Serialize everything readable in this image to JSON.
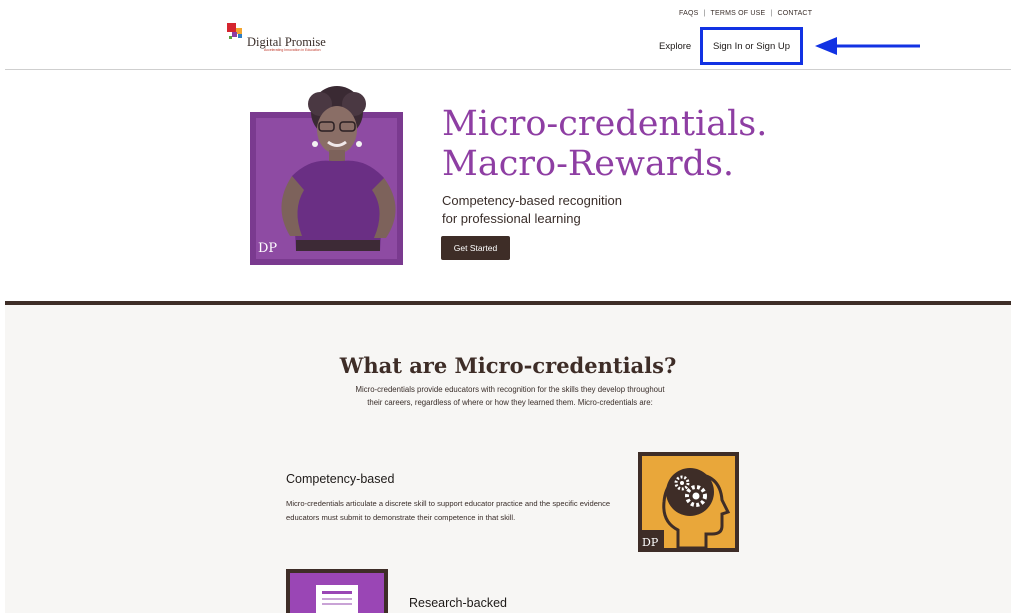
{
  "header": {
    "logo_name": "Digital Promise",
    "logo_tagline": "Accelerating Innovation in Education",
    "utility_links": [
      "FAQS",
      "TERMS OF USE",
      "CONTACT"
    ],
    "explore_label": "Explore",
    "signin_label": "Sign In or Sign Up"
  },
  "hero": {
    "image_badge": "DP",
    "title_line1": "Micro-credentials.",
    "title_line2": "Macro-Rewards.",
    "subtitle_line1": "Competency-based recognition",
    "subtitle_line2": "for professional learning",
    "cta_label": "Get Started"
  },
  "what_section": {
    "title": "What are Micro-credentials?",
    "description": "Micro-credentials provide educators with recognition for the skills they develop throughout their careers, regardless of where or how they learned them. Micro-credentials are:",
    "features": [
      {
        "title": "Competency-based",
        "text": "Micro-credentials articulate a discrete skill to support educator practice and the specific evidence educators must submit to demonstrate their competence in that skill.",
        "icon": "gear-head-icon",
        "badge": "DP"
      },
      {
        "title": "Research-backed",
        "icon": "document-icon"
      }
    ]
  },
  "colors": {
    "brand_purple": "#8e3ea3",
    "brand_brown": "#3e2d27",
    "highlight_blue": "#1232e3",
    "icon_orange": "#e9a73a"
  }
}
